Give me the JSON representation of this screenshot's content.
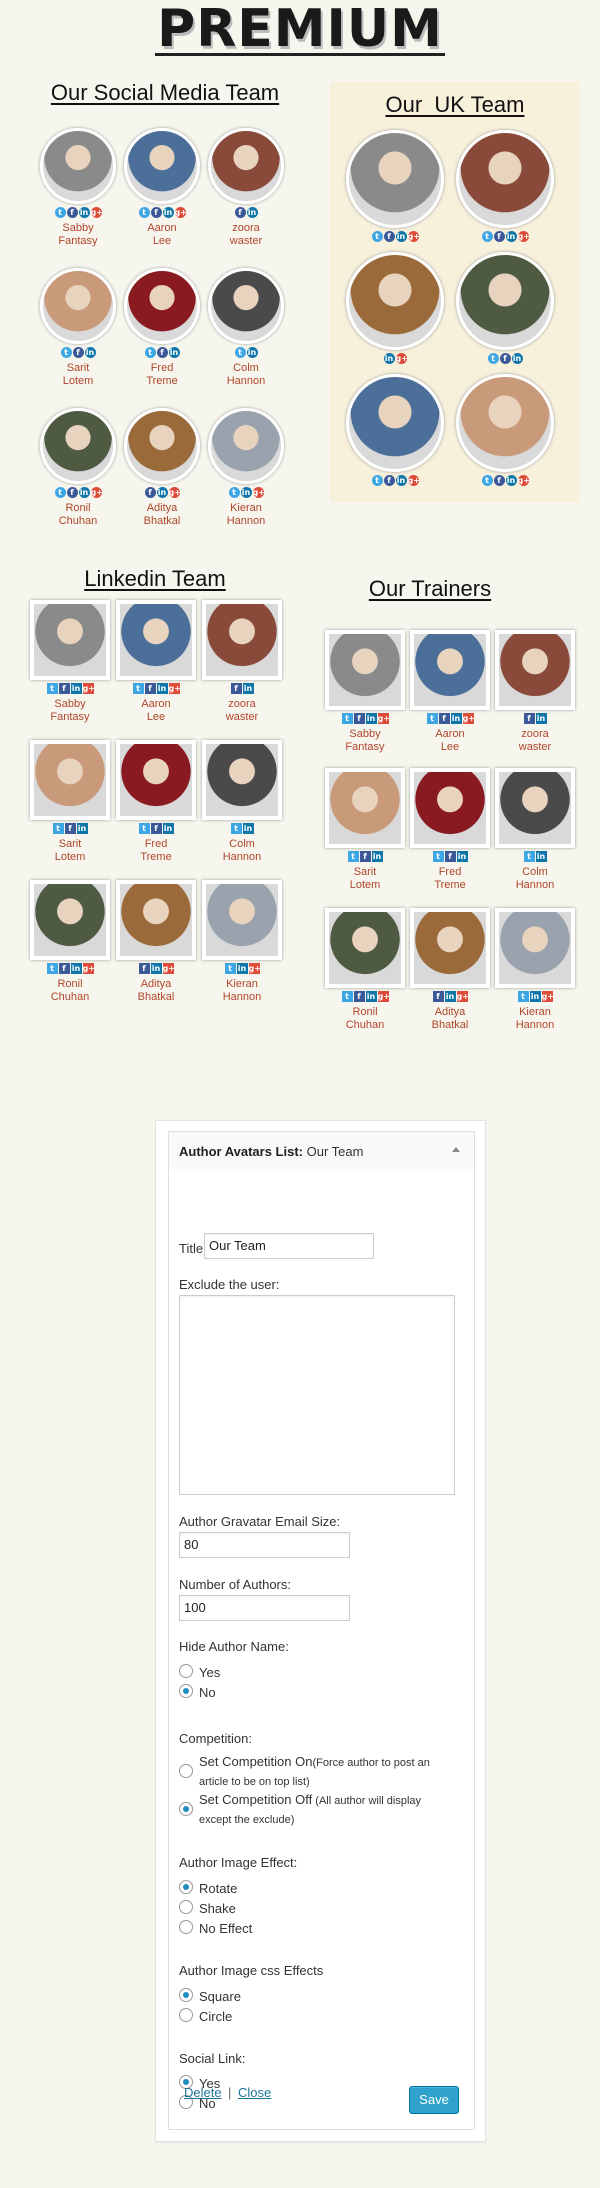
{
  "brand": "PREMIUM",
  "teams": {
    "social": "Our Social Media Team",
    "uk": "Our  UK Team",
    "linkedin": "Linkedin Team",
    "trainers": "Our Trainers"
  },
  "members": [
    {
      "first": "Sabby",
      "last": "Fantasy",
      "photo": "#8a8a8a",
      "icons": [
        "tw",
        "fb",
        "li",
        "gp"
      ]
    },
    {
      "first": "Aaron",
      "last": "Lee",
      "photo": "#4b6f99",
      "icons": [
        "tw",
        "fb",
        "li",
        "gp"
      ]
    },
    {
      "first": "zoora",
      "last": "waster",
      "photo": "#8a4a3a",
      "icons": [
        "fb",
        "li"
      ]
    },
    {
      "first": "Sarit",
      "last": "Lotem",
      "photo": "#c99a7a",
      "icons": [
        "tw",
        "fb",
        "li"
      ]
    },
    {
      "first": "Fred",
      "last": "Treme",
      "photo": "#8a1a22",
      "icons": [
        "tw",
        "fb",
        "li"
      ]
    },
    {
      "first": "Colm",
      "last": "Hannon",
      "photo": "#4a4a4a",
      "icons": [
        "tw",
        "li"
      ]
    },
    {
      "first": "Ronil",
      "last": "Chuhan",
      "photo": "#4e5a42",
      "icons": [
        "tw",
        "fb",
        "li",
        "gp"
      ]
    },
    {
      "first": "Aditya",
      "last": "Bhatkal",
      "photo": "#9b6a3a",
      "icons": [
        "fb",
        "li",
        "gp"
      ]
    },
    {
      "first": "Kieran",
      "last": "Hannon",
      "photo": "#9aa3ad",
      "icons": [
        "tw",
        "li",
        "gp"
      ]
    }
  ],
  "uk_members": [
    {
      "photo": "#8a8a8a",
      "icons": [
        "tw",
        "fb",
        "li",
        "gp"
      ]
    },
    {
      "photo": "#8a4a3a",
      "icons": [
        "tw",
        "fb",
        "li",
        "gp"
      ]
    },
    {
      "photo": "#9b6a3a",
      "icons": [
        "li",
        "gp"
      ]
    },
    {
      "photo": "#4e5a42",
      "icons": [
        "tw",
        "fb",
        "li"
      ]
    },
    {
      "photo": "#4b6f99",
      "icons": [
        "tw",
        "fb",
        "li",
        "gp"
      ]
    },
    {
      "photo": "#c99a7a",
      "icons": [
        "tw",
        "fb",
        "li",
        "gp"
      ]
    }
  ],
  "icon_glyphs": {
    "tw": "t",
    "fb": "f",
    "li": "in",
    "gp": "g+"
  },
  "widget": {
    "header_bold": "Author Avatars List:",
    "header_rest": " Our Team",
    "title_label": "Title:",
    "title_value": "Our Team",
    "exclude_label": "Exclude the user:",
    "email_size_label": "Author Gravatar Email Size:",
    "email_size_value": "80",
    "num_authors_label": "Number of Authors:",
    "num_authors_value": "100",
    "hide_name_label": "Hide Author Name:",
    "hide_yes": "Yes",
    "hide_no": "No",
    "competition_label": "Competition:",
    "comp_on": "Set Competition On",
    "comp_on_note": "(Force author to post an",
    "comp_on_note2": "article to be on top list)",
    "comp_off": "Set Competition Off",
    "comp_off_note": " (All author will display",
    "comp_off_note2": "except the exclude)",
    "effect_label": "Author Image Effect:",
    "effect_rotate": "Rotate",
    "effect_shake": "Shake",
    "effect_none": "No Effect",
    "css_label": "Author Image css Effects",
    "css_square": "Square",
    "css_circle": "Circle",
    "social_label": "Social Link:",
    "social_yes": "Yes",
    "social_no": "No",
    "delete": "Delete",
    "separator": "|",
    "close": "Close",
    "save": "Save"
  },
  "colors": {
    "accent": "#2ea2cc",
    "name": "#b0452a",
    "bg": "#f7f6ee"
  }
}
